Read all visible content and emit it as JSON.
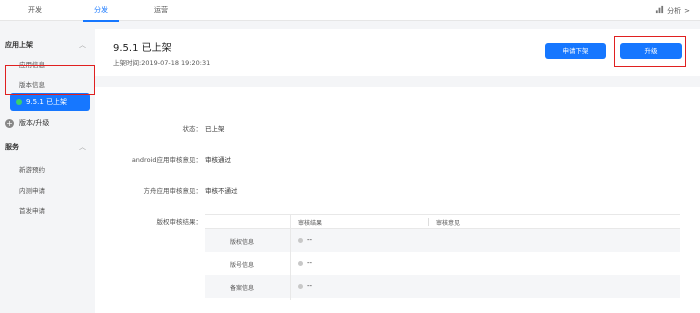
{
  "topnav": {
    "tabs": [
      {
        "label": "开发"
      },
      {
        "label": "分发"
      },
      {
        "label": "运营"
      }
    ],
    "active_tab": "分发",
    "analysis_label": "分析",
    "analysis_chevron": ">"
  },
  "sidebar": {
    "section1_title": "应用上架",
    "section1_items": [
      {
        "label": "应用信息"
      },
      {
        "label": "版本信息"
      }
    ],
    "active_version": "9.5.1 已上架",
    "add_version_label": "版本/升级",
    "section2_title": "服务",
    "section2_items": [
      {
        "label": "新游预约"
      },
      {
        "label": "内测申请"
      },
      {
        "label": "首发申请"
      }
    ]
  },
  "header": {
    "version_title": "9.5.1  已上架",
    "release_time": "上架时间:2019-07-18 19:20:31",
    "btn_unpublish": "申请下架",
    "btn_upgrade": "升级"
  },
  "details": {
    "status_label": "状态：",
    "status_value": "已上架",
    "android_label": "android应用审核意见：",
    "android_value": "审核通过",
    "hm_label": "方舟应用审核意见：",
    "hm_value": "审核不通过",
    "copyright_label": "版权审核结果：",
    "table": {
      "col_result": "审核结果",
      "col_opinion": "审核意见",
      "rows": [
        {
          "name": "版权信息",
          "result": "--"
        },
        {
          "name": "版号信息",
          "result": "--"
        },
        {
          "name": "备案信息",
          "result": "--"
        }
      ]
    }
  },
  "colors": {
    "accent": "#1677ff",
    "highlight": "#e02020",
    "status_dot": "#3bd06a"
  }
}
